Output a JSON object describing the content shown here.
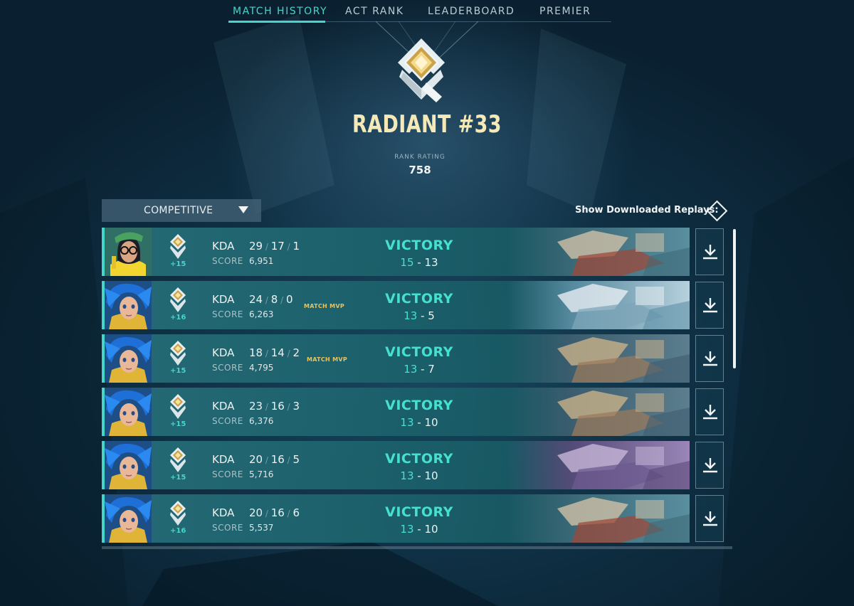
{
  "nav": {
    "tabs": [
      {
        "label": "MATCH HISTORY",
        "active": true
      },
      {
        "label": "ACT RANK",
        "active": false
      },
      {
        "label": "LEADERBOARD",
        "active": false
      },
      {
        "label": "PREMIER",
        "active": false
      }
    ]
  },
  "rank": {
    "title": "RADIANT #33",
    "rating_label": "RANK RATING",
    "rating_value": "758",
    "icon": "radiant-rank-icon"
  },
  "filter": {
    "mode_label": "COMPETITIVE",
    "replays_label": "Show Downloaded Replays:"
  },
  "matches": [
    {
      "agent": "killjoy",
      "rr": "+15",
      "kda_label": "KDA",
      "kills": "29",
      "deaths": "17",
      "assists": "1",
      "score_label": "SCORE",
      "score": "6,951",
      "mvp": "",
      "result": "VICTORY",
      "team_score": "15",
      "enemy_score": "13",
      "map": "map-ascent"
    },
    {
      "agent": "neon",
      "rr": "+16",
      "kda_label": "KDA",
      "kills": "24",
      "deaths": "8",
      "assists": "0",
      "score_label": "SCORE",
      "score": "6,263",
      "mvp": "MATCH MVP",
      "result": "VICTORY",
      "team_score": "13",
      "enemy_score": "5",
      "map": "map-icebox"
    },
    {
      "agent": "neon",
      "rr": "+15",
      "kda_label": "KDA",
      "kills": "18",
      "deaths": "14",
      "assists": "2",
      "score_label": "SCORE",
      "score": "4,795",
      "mvp": "MATCH MVP",
      "result": "VICTORY",
      "team_score": "13",
      "enemy_score": "7",
      "map": "map-split"
    },
    {
      "agent": "neon",
      "rr": "+15",
      "kda_label": "KDA",
      "kills": "23",
      "deaths": "16",
      "assists": "3",
      "score_label": "SCORE",
      "score": "6,376",
      "mvp": "",
      "result": "VICTORY",
      "team_score": "13",
      "enemy_score": "10",
      "map": "map-split"
    },
    {
      "agent": "neon",
      "rr": "+15",
      "kda_label": "KDA",
      "kills": "20",
      "deaths": "16",
      "assists": "5",
      "score_label": "SCORE",
      "score": "5,716",
      "mvp": "",
      "result": "VICTORY",
      "team_score": "13",
      "enemy_score": "10",
      "map": "map-pearl"
    },
    {
      "agent": "neon",
      "rr": "+16",
      "kda_label": "KDA",
      "kills": "20",
      "deaths": "16",
      "assists": "6",
      "score_label": "SCORE",
      "score": "5,537",
      "mvp": "",
      "result": "VICTORY",
      "team_score": "13",
      "enemy_score": "10",
      "map": "map-ascent"
    }
  ],
  "colors": {
    "accent": "#45d6c9",
    "rank_title": "#f5e9b8",
    "mvp": "#e9c45d"
  }
}
